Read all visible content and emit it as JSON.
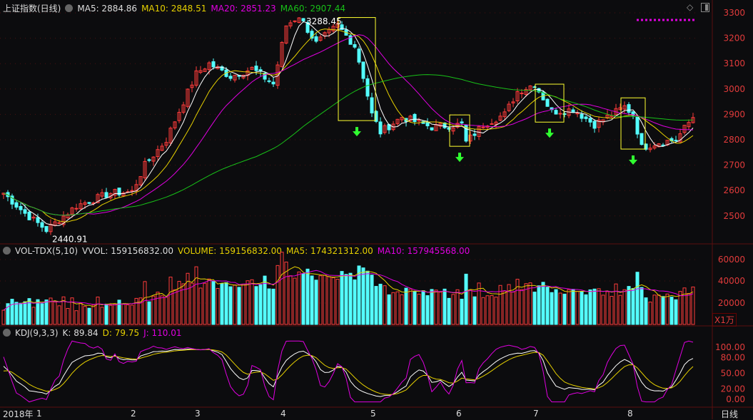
{
  "header": {
    "title": "上证指数(日线)",
    "ma5": "MA5: 2884.86",
    "ma10": "MA10: 2848.51",
    "ma20": "MA20: 2851.23",
    "ma60": "MA60: 2907.44"
  },
  "volume_header": {
    "name": "VOL-TDX(5,10)",
    "vvol": "VVOL: 159156832.00",
    "volume": "VOLUME: 159156832.00",
    "ma5": "MA5: 174321312.00",
    "ma10": "MA10: 157945568.00",
    "unit": "X1万"
  },
  "kdj_header": {
    "name": "KDJ(9,3,3)",
    "k": "K: 89.84",
    "d": "D: 79.75",
    "j": "J: 110.01"
  },
  "bottom": {
    "year": "2018年",
    "period": "日线"
  },
  "colors": {
    "up": "#ff3b3b",
    "down": "#54ffff",
    "ma5": "#ffffff",
    "ma10": "#e6d000",
    "ma20": "#e000e0",
    "ma60": "#18c018",
    "box": "#ffff30",
    "arrow": "#30ff30"
  },
  "chart_data": {
    "type": "candlestick",
    "price_axis": {
      "ticks": [
        "3300",
        "3200",
        "3100",
        "3000",
        "2900",
        "2800",
        "2700",
        "2600",
        "2500"
      ],
      "range": [
        2450,
        3350
      ]
    },
    "volume_axis": {
      "ticks": [
        "60000",
        "40000",
        "20000"
      ]
    },
    "kdj_axis": {
      "ticks": [
        "100.00",
        "80.00",
        "50.00",
        "20.00",
        "0.00"
      ]
    },
    "months": [
      "1",
      "2",
      "3",
      "4",
      "5",
      "6",
      "7",
      "8"
    ],
    "month_start_index": [
      8,
      30,
      45,
      65,
      86,
      106,
      124,
      146
    ],
    "high_label": "3288.45",
    "low_label": "2440.91",
    "price_keypoints": [
      [
        0,
        2590
      ],
      [
        5,
        2510
      ],
      [
        10,
        2445
      ],
      [
        17,
        2540
      ],
      [
        25,
        2590
      ],
      [
        30,
        2595
      ],
      [
        33,
        2700
      ],
      [
        38,
        2800
      ],
      [
        42,
        2950
      ],
      [
        45,
        3060
      ],
      [
        48,
        3100
      ],
      [
        53,
        3050
      ],
      [
        58,
        3080
      ],
      [
        63,
        3020
      ],
      [
        66,
        3250
      ],
      [
        69,
        3288
      ],
      [
        73,
        3180
      ],
      [
        78,
        3250
      ],
      [
        82,
        3170
      ],
      [
        84,
        3050
      ],
      [
        86,
        2900
      ],
      [
        88,
        2830
      ],
      [
        93,
        2890
      ],
      [
        100,
        2850
      ],
      [
        107,
        2860
      ],
      [
        108,
        2790
      ],
      [
        112,
        2860
      ],
      [
        117,
        2900
      ],
      [
        120,
        2990
      ],
      [
        124,
        3020
      ],
      [
        128,
        2910
      ],
      [
        133,
        2920
      ],
      [
        138,
        2860
      ],
      [
        145,
        2930
      ],
      [
        147,
        2900
      ],
      [
        149,
        2770
      ],
      [
        153,
        2790
      ],
      [
        157,
        2800
      ],
      [
        161,
        2890
      ]
    ],
    "highlight_ranges": [
      [
        79,
        86
      ],
      [
        105,
        108
      ],
      [
        125,
        130
      ],
      [
        145,
        149
      ]
    ]
  }
}
